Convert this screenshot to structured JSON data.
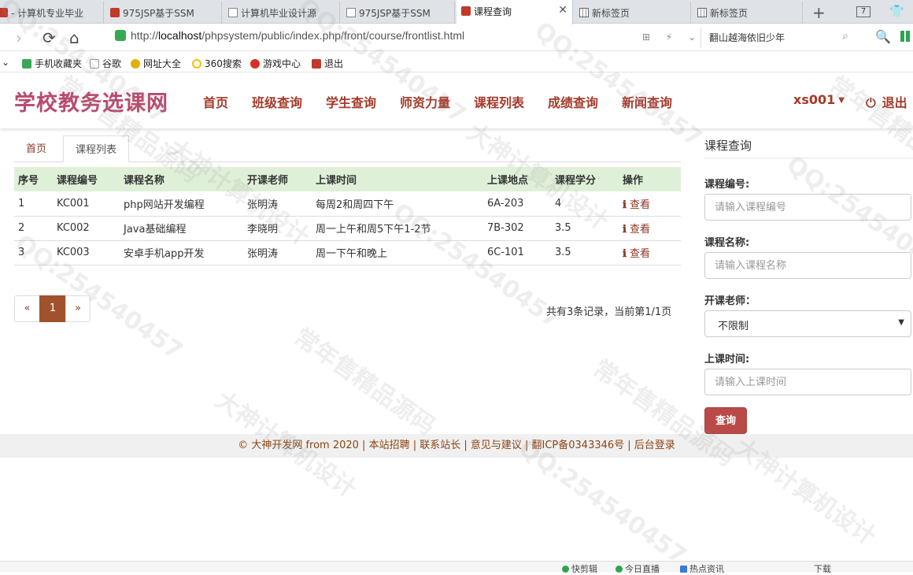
{
  "browser": {
    "tabs": [
      {
        "title": "- 计算机专业毕业",
        "icon": "red"
      },
      {
        "title": "975JSP基于SSM",
        "icon": "red"
      },
      {
        "title": "计算机毕业设计源",
        "icon": "page"
      },
      {
        "title": "975JSP基于SSM",
        "icon": "page"
      },
      {
        "title": "课程查询",
        "icon": "red",
        "active": true
      },
      {
        "title": "新标签页",
        "icon": "grid"
      },
      {
        "title": "新标签页",
        "icon": "grid"
      }
    ],
    "tab_count": "7",
    "url_prefix": "http://",
    "url_host": "localhost",
    "url_path": "/phpsystem/public/index.php/front/course/frontlist.html",
    "search_text": "翻山越海依旧少年",
    "bookmarks": [
      {
        "label": "手机收藏夹",
        "color": "#3aa757"
      },
      {
        "label": "谷歌",
        "color": "#ffffff"
      },
      {
        "label": "网址大全",
        "color": "#e2b007"
      },
      {
        "label": "360搜索",
        "color": "#f2c200"
      },
      {
        "label": "游戏中心",
        "color": "#d93025"
      },
      {
        "label": "退出",
        "color": "#c0392b"
      }
    ]
  },
  "site": {
    "brand": "学校教务选课网",
    "nav": [
      "首页",
      "班级查询",
      "学生查询",
      "师资力量",
      "课程列表",
      "成绩查询",
      "新闻查询"
    ],
    "user": "xs001",
    "logout": "退出"
  },
  "content_tabs": [
    "首页",
    "课程列表"
  ],
  "table": {
    "headers": [
      "序号",
      "课程编号",
      "课程名称",
      "开课老师",
      "上课时间",
      "上课地点",
      "课程学分",
      "操作"
    ],
    "rows": [
      [
        "1",
        "KC001",
        "php网站开发编程",
        "张明涛",
        "每周2和周四下午",
        "6A-203",
        "4",
        "查看"
      ],
      [
        "2",
        "KC002",
        "Java基础编程",
        "李晓明",
        "周一上午和周5下午1-2节",
        "7B-302",
        "3.5",
        "查看"
      ],
      [
        "3",
        "KC003",
        "安卓手机app开发",
        "张明涛",
        "周一下午和晚上",
        "6C-101",
        "3.5",
        "查看"
      ]
    ]
  },
  "pager": {
    "prev": "«",
    "current": "1",
    "next": "»",
    "summary": "共有3条记录，当前第1/1页"
  },
  "search_panel": {
    "title": "课程查询",
    "code_label": "课程编号:",
    "code_placeholder": "请输入课程编号",
    "name_label": "课程名称:",
    "name_placeholder": "请输入课程名称",
    "teacher_label": "开课老师：",
    "teacher_value": "不限制",
    "time_label": "上课时间:",
    "time_placeholder": "请输入上课时间",
    "button": "查询"
  },
  "footer": "© 大神开发网 from 2020 | 本站招聘 | 联系站长 | 意见与建议 | 翻ICP备0343346号 | 后台登录",
  "statusbar": [
    "快剪辑",
    "今日直播",
    "热点资讯",
    "下载"
  ],
  "watermark": [
    "QQ:254540457",
    "大神计算机设计",
    "常年售精品源码"
  ],
  "colors": {
    "brand": "#b94a6d",
    "nav": "#a33a2a",
    "table_head": "#dff0d8",
    "page_active": "#a0522d",
    "query_button": "#b94a48"
  }
}
